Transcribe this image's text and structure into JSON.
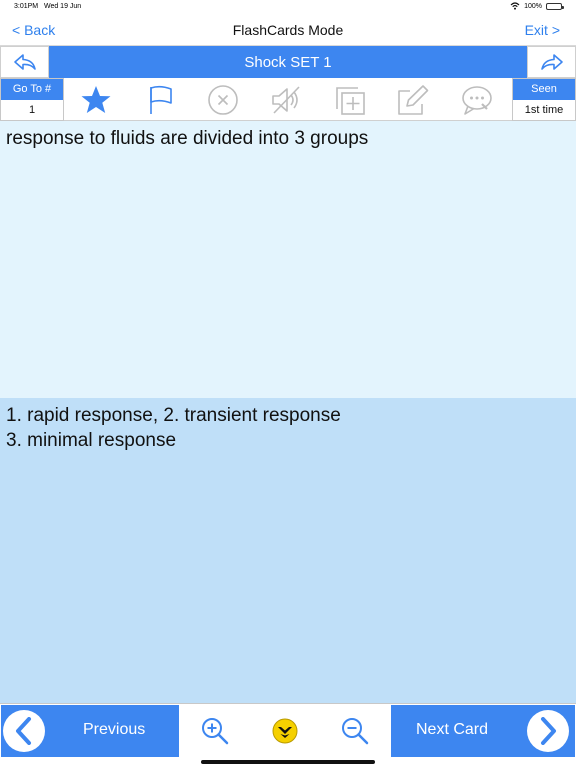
{
  "status_bar": {
    "time": "3:01PM",
    "date": "Wed 19 Jun",
    "battery": "100%",
    "icons": {
      "wifi": "wifi-icon",
      "battery": "battery-icon"
    }
  },
  "nav_bar": {
    "back_label": "< Back",
    "title": "FlashCards Mode",
    "exit_label": "Exit >"
  },
  "set_bar": {
    "title": "Shock SET 1",
    "icons": {
      "left": "reply-arrow-icon",
      "right": "forward-arrow-icon"
    }
  },
  "toolbar": {
    "goto": {
      "label": "Go To #",
      "value": "1"
    },
    "seen": {
      "label": "Seen",
      "value": "1st time"
    },
    "icons": [
      "star-icon",
      "flag-icon",
      "close-circle-icon",
      "audio-muted-icon",
      "add-card-icon",
      "edit-icon",
      "comment-icon"
    ]
  },
  "card": {
    "question": "response to fluids are divided into 3 groups",
    "answer_lines": [
      "1. rapid response, 2. transient response",
      "3. minimal response"
    ]
  },
  "bottom_bar": {
    "previous_label": "Previous",
    "next_label": "Next Card",
    "icons": [
      "chevron-left-icon",
      "zoom-in-icon",
      "shuffle-toggle-icon",
      "zoom-out-icon",
      "chevron-right-icon"
    ]
  },
  "colors": {
    "accent": "#3d86f0",
    "question_bg": "#e3f4fd",
    "answer_bg": "#bfdff8",
    "link": "#2f80ed"
  }
}
